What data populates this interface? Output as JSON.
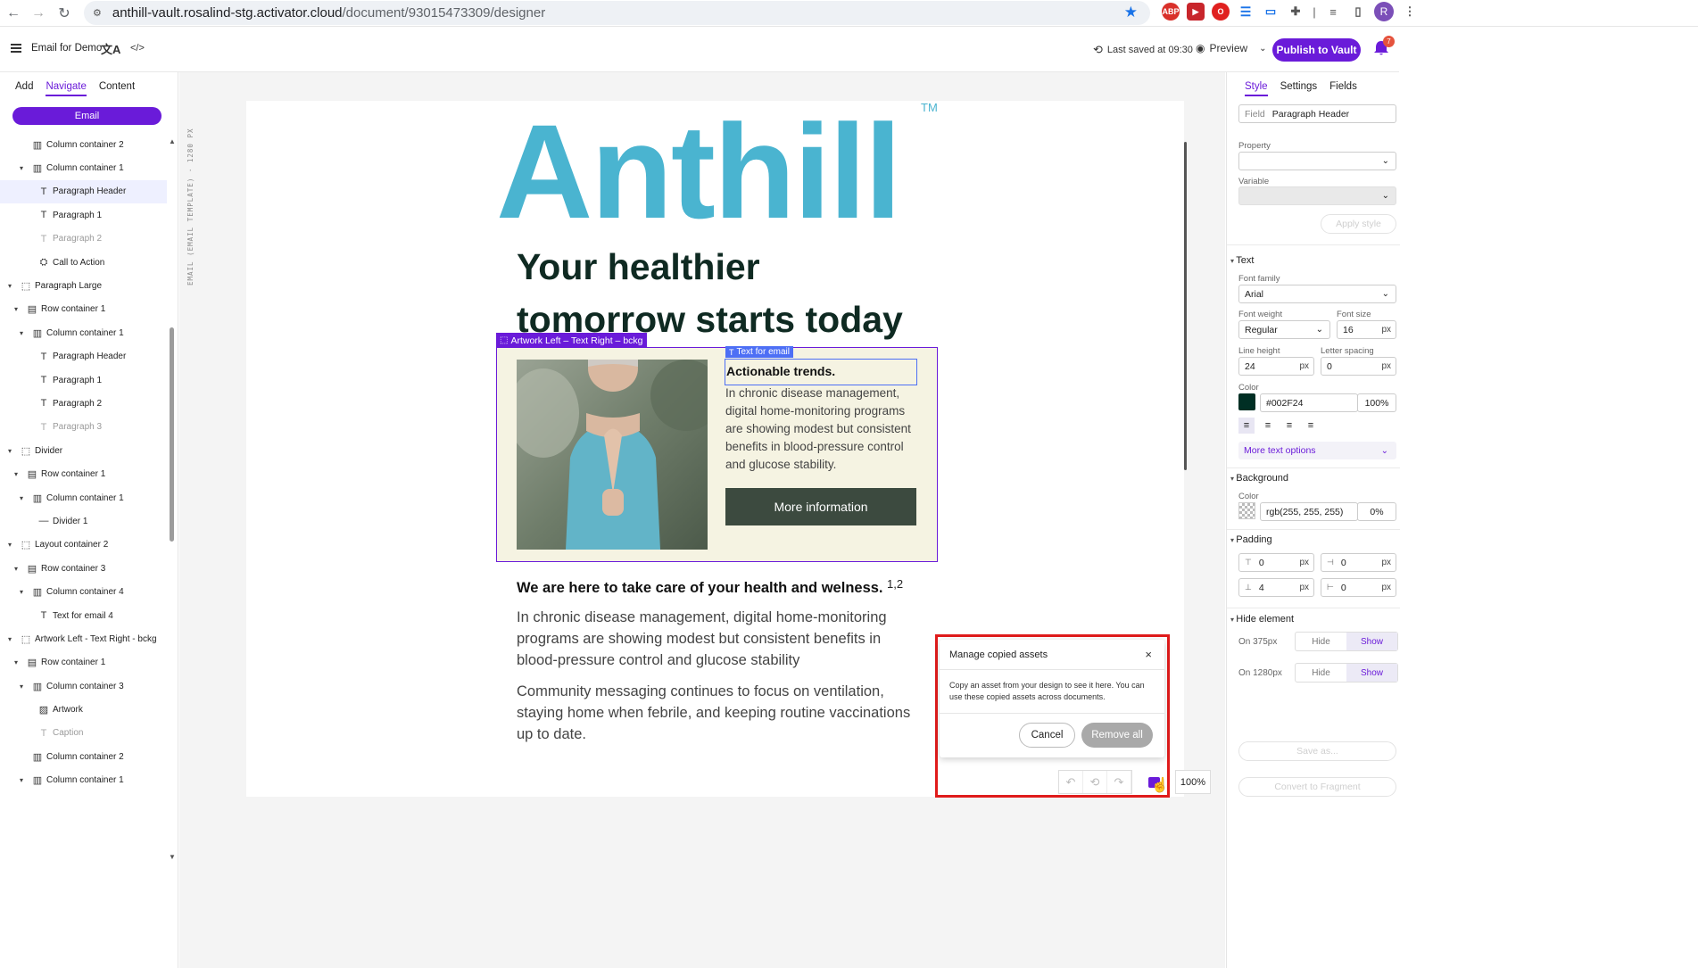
{
  "browser": {
    "url_host": "anthill-vault.rosalind-stg.activator.cloud",
    "url_path": "/document/93015473309/designer"
  },
  "header": {
    "doc_title": "Email for Demo",
    "saved": "Last saved at 09:30",
    "preview": "Preview",
    "publish": "Publish to Vault",
    "notifications": "7"
  },
  "left_panel": {
    "tabs": [
      "Add",
      "Navigate",
      "Content"
    ],
    "email_label": "Email",
    "tree": [
      {
        "label": "Column container 2",
        "depth": 3,
        "icon": "column",
        "caret": false
      },
      {
        "label": "Column container 1",
        "depth": 3,
        "icon": "column",
        "caret": true
      },
      {
        "label": "Paragraph Header",
        "depth": 4,
        "icon": "text",
        "selected": true
      },
      {
        "label": "Paragraph 1",
        "depth": 4,
        "icon": "text"
      },
      {
        "label": "Paragraph 2",
        "depth": 4,
        "icon": "text",
        "muted": true
      },
      {
        "label": "Call to Action",
        "depth": 4,
        "icon": "cta"
      },
      {
        "label": "Paragraph Large",
        "depth": 1,
        "icon": "layout",
        "caret": true
      },
      {
        "label": "Row container 1",
        "depth": 2,
        "icon": "row",
        "caret": true
      },
      {
        "label": "Column container 1",
        "depth": 3,
        "icon": "column",
        "caret": true
      },
      {
        "label": "Paragraph Header",
        "depth": 4,
        "icon": "text"
      },
      {
        "label": "Paragraph 1",
        "depth": 4,
        "icon": "text"
      },
      {
        "label": "Paragraph 2",
        "depth": 4,
        "icon": "text"
      },
      {
        "label": "Paragraph 3",
        "depth": 4,
        "icon": "text",
        "muted": true
      },
      {
        "label": "Divider",
        "depth": 1,
        "icon": "layout",
        "caret": true
      },
      {
        "label": "Row container 1",
        "depth": 2,
        "icon": "row",
        "caret": true
      },
      {
        "label": "Column container 1",
        "depth": 3,
        "icon": "column",
        "caret": true
      },
      {
        "label": "Divider 1",
        "depth": 4,
        "icon": "divider"
      },
      {
        "label": "Layout container 2",
        "depth": 1,
        "icon": "layout",
        "caret": true
      },
      {
        "label": "Row container 3",
        "depth": 2,
        "icon": "row",
        "caret": true
      },
      {
        "label": "Column container 4",
        "depth": 3,
        "icon": "column",
        "caret": true
      },
      {
        "label": "Text for email 4",
        "depth": 4,
        "icon": "text"
      },
      {
        "label": "Artwork Left - Text Right - bckg",
        "depth": 1,
        "icon": "layout",
        "caret": true
      },
      {
        "label": "Row container 1",
        "depth": 2,
        "icon": "row",
        "caret": true
      },
      {
        "label": "Column container 3",
        "depth": 3,
        "icon": "column",
        "caret": true
      },
      {
        "label": "Artwork",
        "depth": 4,
        "icon": "image"
      },
      {
        "label": "Caption",
        "depth": 4,
        "icon": "text",
        "muted": true
      },
      {
        "label": "Column container 2",
        "depth": 3,
        "icon": "column"
      },
      {
        "label": "Column container 1",
        "depth": 3,
        "icon": "column",
        "caret": true
      }
    ]
  },
  "canvas": {
    "ruler": "EMAIL (EMAIL TEMPLATE) · 1280 PX",
    "logo": "Anthill",
    "logo_tm": "TM",
    "hero_title": "Your healthier tomorrow starts today",
    "selection_tag": "Artwork Left – Text Right – bckg",
    "text_tag": "Text for email",
    "card_heading": "Actionable trends.",
    "card_body": "In chronic disease management, digital home-monitoring programs are showing modest but consistent benefits in blood-pressure control and glucose stability.",
    "card_button": "More information",
    "section_heading": "We are here to take care of your health and welness.",
    "section_sup": "1,2",
    "section_p1": "In chronic disease management, digital home-monitoring programs are showing modest but consistent benefits in blood-pressure control and glucose stability",
    "section_p2": "Community messaging continues to focus on ventilation, staying home when febrile, and keeping routine vaccinations up to date.",
    "zoom": "100%"
  },
  "dialog": {
    "title": "Manage copied assets",
    "text": "Copy an asset from your design to see it here. You can use these copied assets across documents.",
    "cancel": "Cancel",
    "remove_all": "Remove all"
  },
  "right_panel": {
    "tabs": [
      "Style",
      "Settings",
      "Fields"
    ],
    "field_label": "Field",
    "field_value": "Paragraph Header",
    "property_label": "Property",
    "variable_label": "Variable",
    "apply_style": "Apply style",
    "text_section": "Text",
    "font_family_label": "Font family",
    "font_family": "Arial",
    "font_weight_label": "Font weight",
    "font_weight": "Regular",
    "font_size_label": "Font size",
    "font_size": "16",
    "line_height_label": "Line height",
    "line_height": "24",
    "letter_spacing_label": "Letter spacing",
    "letter_spacing": "0",
    "unit": "px",
    "color_label": "Color",
    "text_color": "#002F24",
    "text_opacity": "100%",
    "more_text": "More text options",
    "background_section": "Background",
    "bg_color_label": "Color",
    "bg_color": "rgb(255, 255, 255)",
    "bg_opacity": "0%",
    "padding_section": "Padding",
    "pad_top": "0",
    "pad_right": "0",
    "pad_bottom": "4",
    "pad_left": "0",
    "hide_section": "Hide element",
    "on375": "On 375px",
    "on1280": "On 1280px",
    "hide": "Hide",
    "show": "Show",
    "save_as": "Save as...",
    "convert": "Convert to Fragment"
  },
  "colors": {
    "accent": "#6a1bd9",
    "logo": "#4ab4d0",
    "card_bg": "#f5f3e2",
    "button_bg": "#3c4a3f",
    "text_swatch": "#002F24"
  }
}
